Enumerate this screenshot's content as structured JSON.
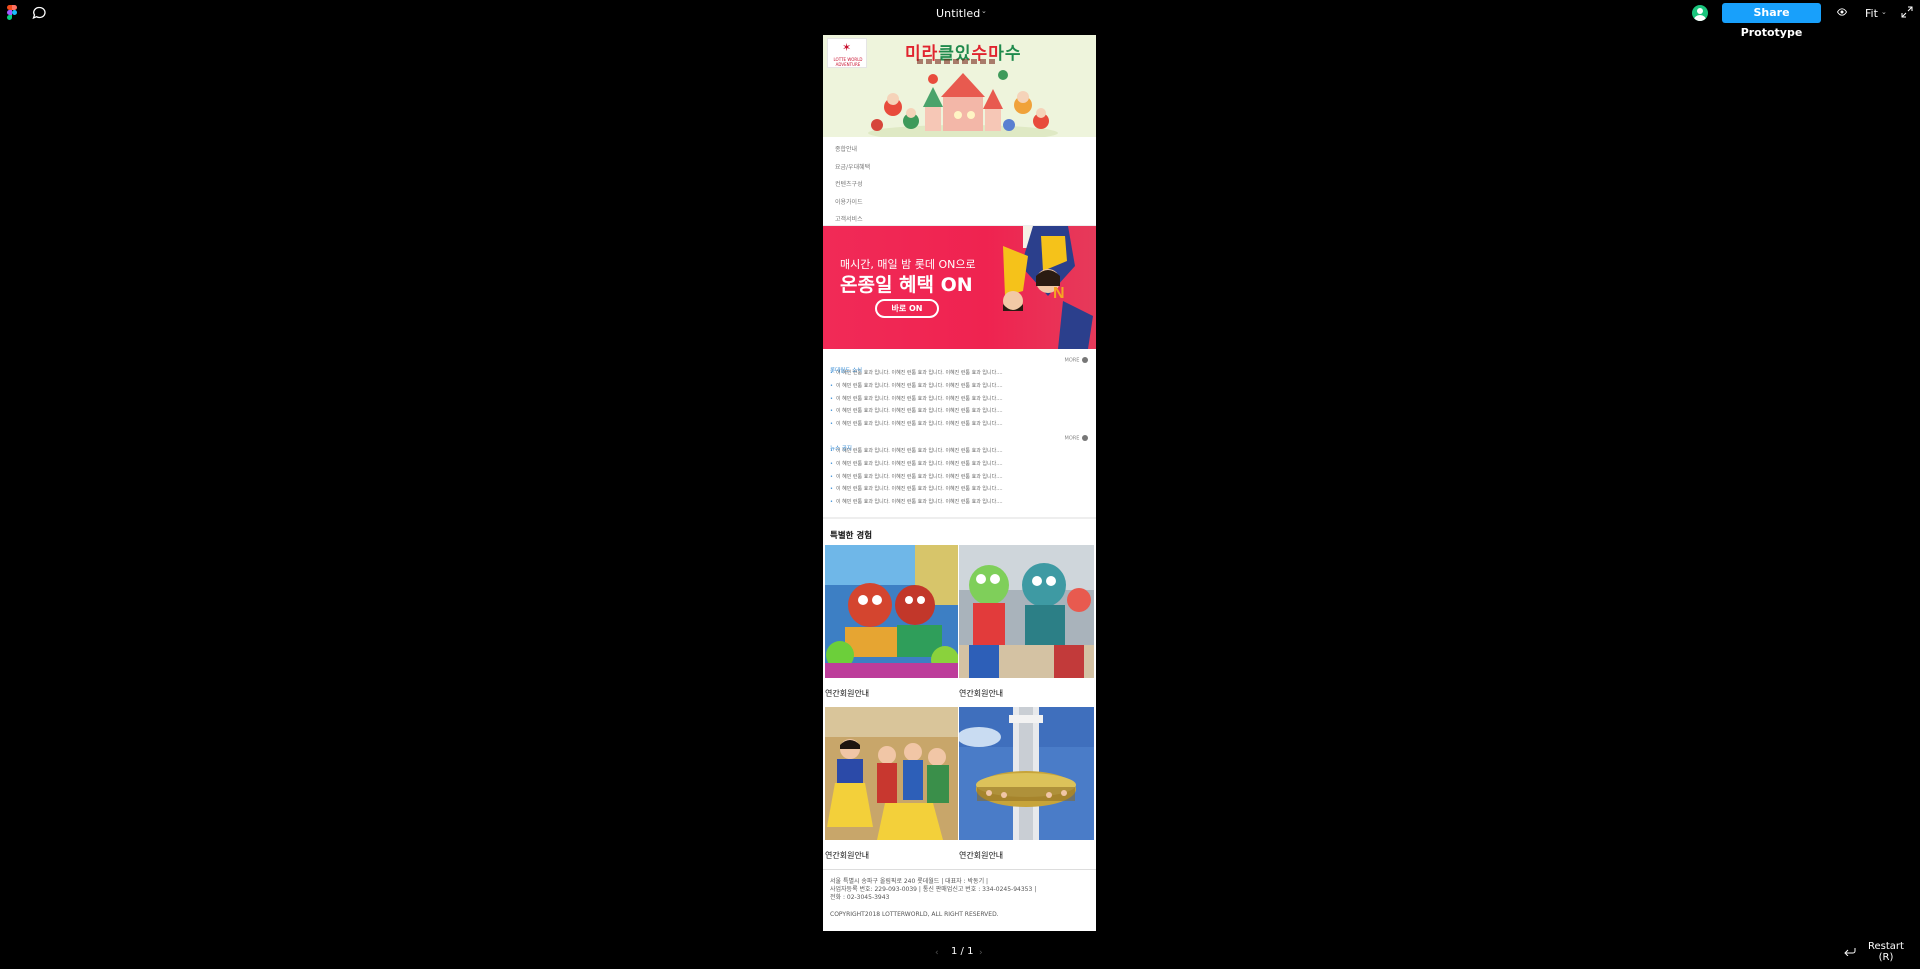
{
  "toolbar": {
    "document_title": "Untitled",
    "share_label": "Share Prototype",
    "zoom_label": "Fit"
  },
  "frame": {
    "hero": {
      "logo_text": "LOTTE WORLD ADVENTURE",
      "title": "미라클있수마수"
    },
    "menu": [
      "종합안내",
      "요금/우대혜택",
      "컨텐츠구성",
      "이용가이드",
      "고객서비스"
    ],
    "promo": {
      "line1": "매시간, 매일 밤 롯데 ON으로",
      "line2": "온종일 혜택 ON",
      "button": "바로 ON"
    },
    "notices": {
      "title": "롯데월드 소식",
      "more": "MORE",
      "items": [
        "이 혜민 런툼 효과 입니다. 이혜진 런툼 효과 입니다. 이혜진 런툼 효과 입니다....",
        "이 혜민 런툼 효과 입니다. 이혜진 런툼 효과 입니다. 이혜진 런툼 효과 입니다....",
        "이 혜민 런툼 효과 입니다. 이혜진 런툼 효과 입니다. 이혜진 런툼 효과 입니다....",
        "이 혜민 런툼 효과 입니다. 이혜진 런툼 효과 입니다. 이혜진 런툼 효과 입니다....",
        "이 혜민 런툼 효과 입니다. 이혜진 런툼 효과 입니다. 이혜진 런툼 효과 입니다...."
      ]
    },
    "news": {
      "title": "뉴스 공지",
      "more": "MORE",
      "items": [
        "이 혜민 런툼 효과 입니다. 이혜진 런툼 효과 입니다. 이혜진 런툼 효과 입니다....",
        "이 혜민 런툼 효과 입니다. 이혜진 런툼 효과 입니다. 이혜진 런툼 효과 입니다....",
        "이 혜민 런툼 효과 입니다. 이혜진 런툼 효과 입니다. 이혜진 런툼 효과 입니다....",
        "이 혜민 런툼 효과 입니다. 이혜진 런툼 효과 입니다. 이혜진 런툼 효과 입니다....",
        "이 혜민 런툼 효과 입니다. 이혜진 런툼 효과 입니다. 이혜진 런툼 효과 입니다...."
      ]
    },
    "special": {
      "title": "특별한 경험",
      "cards": [
        {
          "label": "연간회원안내",
          "image": "parade-mascots"
        },
        {
          "label": "연간회원안내",
          "image": "dino-mascot"
        },
        {
          "label": "연간회원안내",
          "image": "snow-white-dwarfs"
        },
        {
          "label": "연간회원안내",
          "image": "gyro-drop-tower"
        }
      ]
    },
    "footer": {
      "address": "서울 특별시 송파구 올림픽로 240 롯데월드 | 대표자 : 박동기 |",
      "business": "사업자등록 번호: 229-093-0039 | 통신 판매업신고 번호 : 334-0245-94353 |",
      "phone": "전화 : 02-3045-3943",
      "copyright": "COPYRIGHT2018 LOTTERWORLD, ALL RIGHT RESERVED."
    }
  },
  "pager": "1 / 1",
  "restart": {
    "label": "Restart",
    "shortcut": "(R)"
  },
  "colors": {
    "accent": "#18a0fb",
    "avatar": "#1bc47d",
    "promo_red": "#f12a57",
    "link_blue": "#3c8fd6"
  }
}
